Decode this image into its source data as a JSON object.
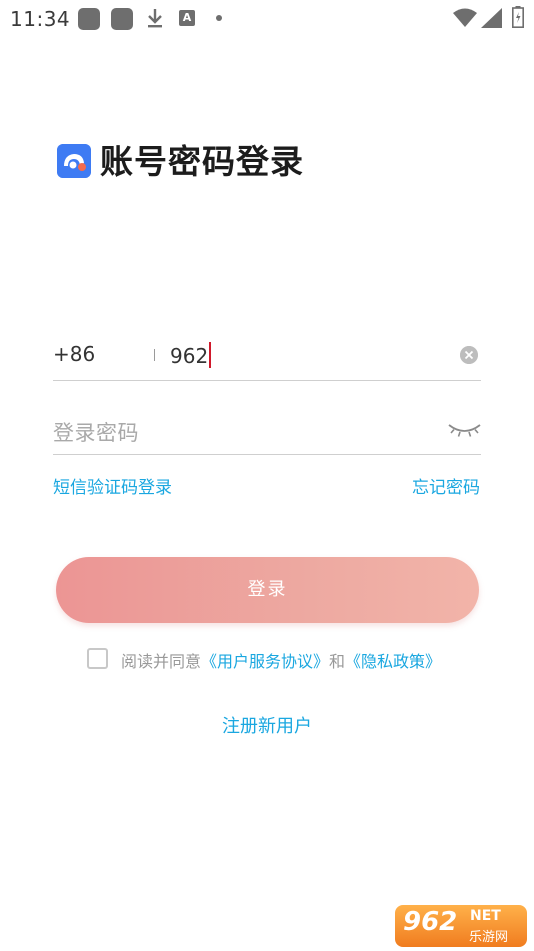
{
  "status_bar": {
    "time": "11:34",
    "icons": [
      "app-square-icon",
      "app-square-icon",
      "download-icon",
      "a-badge-icon",
      "dot-icon",
      "wifi-icon",
      "signal-icon",
      "battery-icon"
    ]
  },
  "header": {
    "title": "账号密码登录",
    "icon": "app-logo-icon",
    "icon_color": "#3e7bf3"
  },
  "form": {
    "country_code": "+86",
    "phone_value": "962",
    "password_placeholder": "登录密码",
    "clear_icon": "clear-icon",
    "visibility_icon": "eye-closed-icon"
  },
  "links": {
    "sms_login": "短信验证码登录",
    "forgot_password": "忘记密码"
  },
  "login_button": {
    "label": "登录",
    "gradient": [
      "#ec9594",
      "#f2b4a9"
    ]
  },
  "agreement": {
    "prefix": "阅读并同意",
    "terms": "《用户服务协议》",
    "conjunction": "和",
    "privacy": "《隐私政策》",
    "checked": false
  },
  "register": {
    "label": "注册新用户"
  },
  "watermark": {
    "number": "962",
    "suffix": "NET",
    "cn": "乐游网"
  },
  "colors": {
    "accent": "#1aa7e0",
    "caret": "#d0192b"
  }
}
